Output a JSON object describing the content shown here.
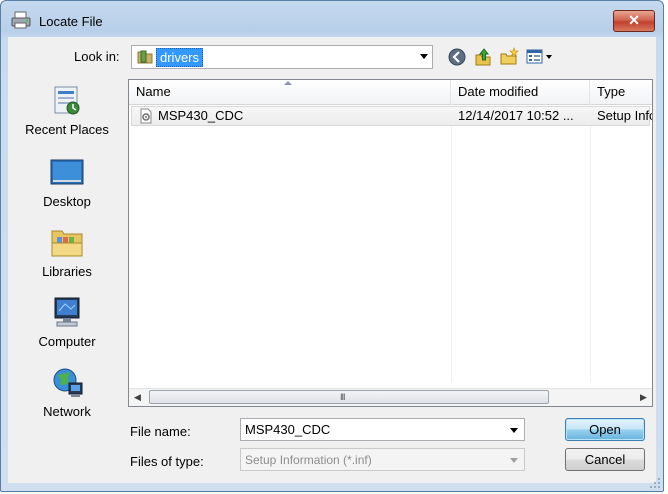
{
  "window": {
    "title": "Locate File",
    "close_label": "✕"
  },
  "lookin": {
    "label": "Look in:",
    "value": "drivers"
  },
  "toolbar": {
    "back_icon": "back-arrow-icon",
    "up_icon": "up-folder-icon",
    "new_folder_icon": "new-folder-icon",
    "views_icon": "views-menu-icon"
  },
  "places": [
    {
      "label": "Recent Places",
      "icon": "recent-places-icon"
    },
    {
      "label": "Desktop",
      "icon": "desktop-icon"
    },
    {
      "label": "Libraries",
      "icon": "libraries-icon"
    },
    {
      "label": "Computer",
      "icon": "computer-icon"
    },
    {
      "label": "Network",
      "icon": "network-icon"
    }
  ],
  "columns": [
    "Name",
    "Date modified",
    "Type"
  ],
  "files": [
    {
      "name": "MSP430_CDC",
      "date": "12/14/2017 10:52 ...",
      "type": "Setup Infc",
      "icon": "setup-information-file-icon"
    }
  ],
  "scrollbar": {
    "left": "◀",
    "right": "▶",
    "grip": "III"
  },
  "filename": {
    "label": "File name:",
    "value": "MSP430_CDC"
  },
  "filetype": {
    "label": "Files of type:",
    "value": "Setup Information (*.inf)"
  },
  "buttons": {
    "open": "Open",
    "cancel": "Cancel"
  }
}
